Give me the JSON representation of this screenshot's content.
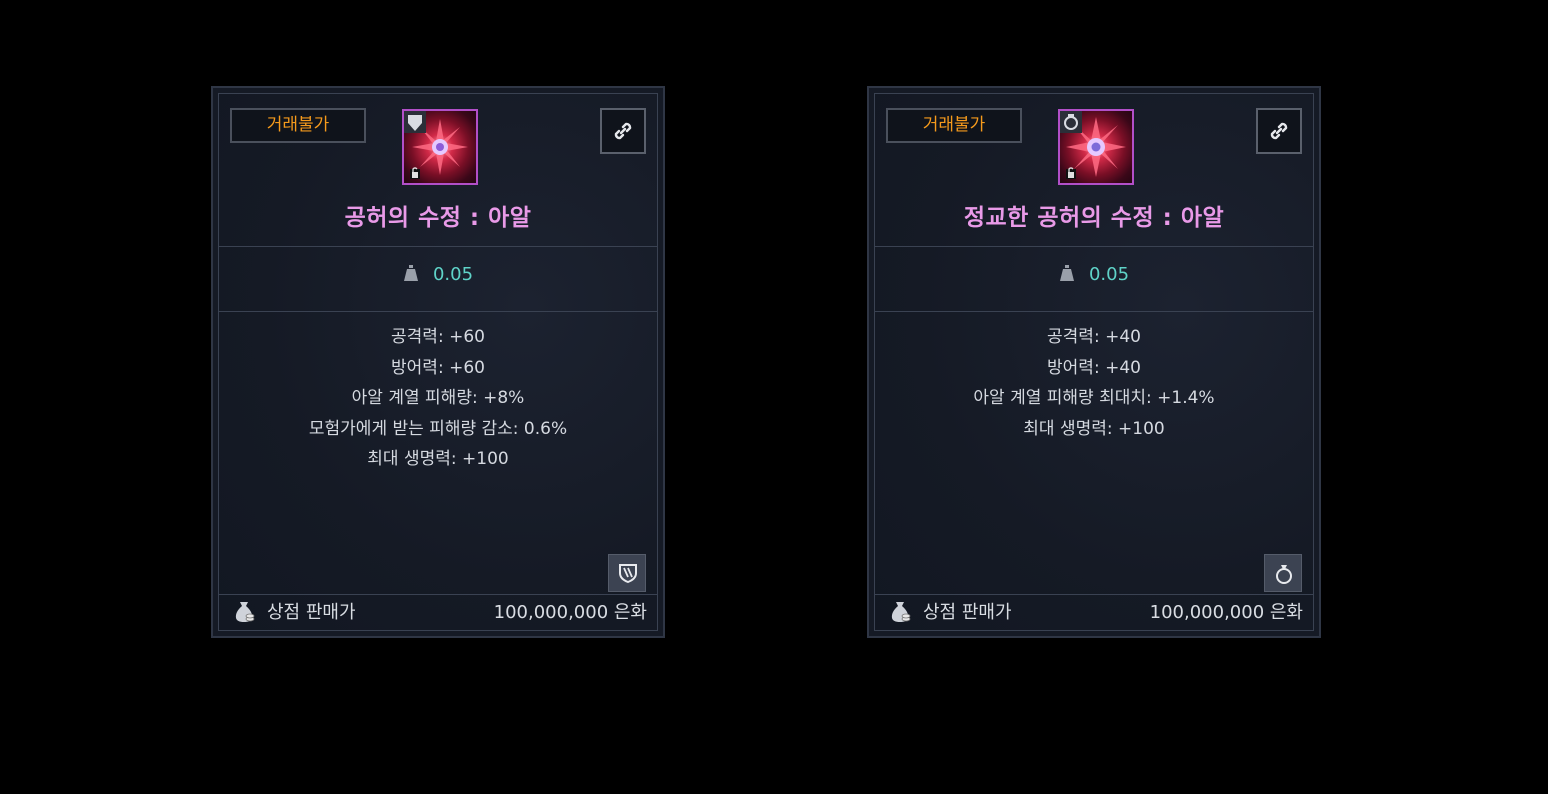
{
  "cards": [
    {
      "badge": "거래불가",
      "item_name": "공허의 수정 : 아알",
      "weight": "0.05",
      "stats": [
        "공격력: +60",
        "방어력: +60",
        "아알 계열 피해량: +8%",
        "모험가에게 받는 피해량 감소: 0.6%",
        "최대 생명력: +100"
      ],
      "type_icon": "shield-icon",
      "shop_label": "상점 판매가",
      "price": "100,000,000 은화"
    },
    {
      "badge": "거래불가",
      "item_name": "정교한 공허의 수정 : 아알",
      "weight": "0.05",
      "stats": [
        "공격력: +40",
        "방어력: +40",
        "아알 계열 피해량 최대치: +1.4%",
        "최대 생명력: +100"
      ],
      "type_icon": "ring-icon",
      "shop_label": "상점 판매가",
      "price": "100,000,000 은화"
    }
  ],
  "colors": {
    "badge_text": "#f59a1c",
    "item_name": "#e99ae8",
    "weight": "#5fd3c8",
    "icon_border": "#b24fc8"
  }
}
